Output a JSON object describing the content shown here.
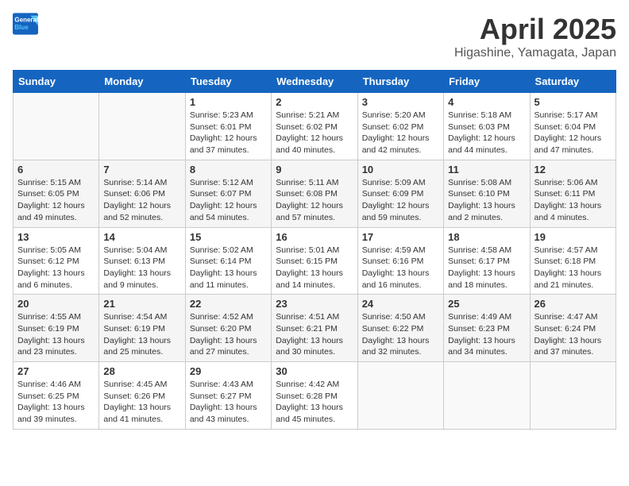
{
  "logo": {
    "line1": "General",
    "line2": "Blue"
  },
  "title": "April 2025",
  "subtitle": "Higashine, Yamagata, Japan",
  "days_of_week": [
    "Sunday",
    "Monday",
    "Tuesday",
    "Wednesday",
    "Thursday",
    "Friday",
    "Saturday"
  ],
  "weeks": [
    [
      {
        "day": "",
        "info": ""
      },
      {
        "day": "",
        "info": ""
      },
      {
        "day": "1",
        "info": "Sunrise: 5:23 AM\nSunset: 6:01 PM\nDaylight: 12 hours and 37 minutes."
      },
      {
        "day": "2",
        "info": "Sunrise: 5:21 AM\nSunset: 6:02 PM\nDaylight: 12 hours and 40 minutes."
      },
      {
        "day": "3",
        "info": "Sunrise: 5:20 AM\nSunset: 6:02 PM\nDaylight: 12 hours and 42 minutes."
      },
      {
        "day": "4",
        "info": "Sunrise: 5:18 AM\nSunset: 6:03 PM\nDaylight: 12 hours and 44 minutes."
      },
      {
        "day": "5",
        "info": "Sunrise: 5:17 AM\nSunset: 6:04 PM\nDaylight: 12 hours and 47 minutes."
      }
    ],
    [
      {
        "day": "6",
        "info": "Sunrise: 5:15 AM\nSunset: 6:05 PM\nDaylight: 12 hours and 49 minutes."
      },
      {
        "day": "7",
        "info": "Sunrise: 5:14 AM\nSunset: 6:06 PM\nDaylight: 12 hours and 52 minutes."
      },
      {
        "day": "8",
        "info": "Sunrise: 5:12 AM\nSunset: 6:07 PM\nDaylight: 12 hours and 54 minutes."
      },
      {
        "day": "9",
        "info": "Sunrise: 5:11 AM\nSunset: 6:08 PM\nDaylight: 12 hours and 57 minutes."
      },
      {
        "day": "10",
        "info": "Sunrise: 5:09 AM\nSunset: 6:09 PM\nDaylight: 12 hours and 59 minutes."
      },
      {
        "day": "11",
        "info": "Sunrise: 5:08 AM\nSunset: 6:10 PM\nDaylight: 13 hours and 2 minutes."
      },
      {
        "day": "12",
        "info": "Sunrise: 5:06 AM\nSunset: 6:11 PM\nDaylight: 13 hours and 4 minutes."
      }
    ],
    [
      {
        "day": "13",
        "info": "Sunrise: 5:05 AM\nSunset: 6:12 PM\nDaylight: 13 hours and 6 minutes."
      },
      {
        "day": "14",
        "info": "Sunrise: 5:04 AM\nSunset: 6:13 PM\nDaylight: 13 hours and 9 minutes."
      },
      {
        "day": "15",
        "info": "Sunrise: 5:02 AM\nSunset: 6:14 PM\nDaylight: 13 hours and 11 minutes."
      },
      {
        "day": "16",
        "info": "Sunrise: 5:01 AM\nSunset: 6:15 PM\nDaylight: 13 hours and 14 minutes."
      },
      {
        "day": "17",
        "info": "Sunrise: 4:59 AM\nSunset: 6:16 PM\nDaylight: 13 hours and 16 minutes."
      },
      {
        "day": "18",
        "info": "Sunrise: 4:58 AM\nSunset: 6:17 PM\nDaylight: 13 hours and 18 minutes."
      },
      {
        "day": "19",
        "info": "Sunrise: 4:57 AM\nSunset: 6:18 PM\nDaylight: 13 hours and 21 minutes."
      }
    ],
    [
      {
        "day": "20",
        "info": "Sunrise: 4:55 AM\nSunset: 6:19 PM\nDaylight: 13 hours and 23 minutes."
      },
      {
        "day": "21",
        "info": "Sunrise: 4:54 AM\nSunset: 6:19 PM\nDaylight: 13 hours and 25 minutes."
      },
      {
        "day": "22",
        "info": "Sunrise: 4:52 AM\nSunset: 6:20 PM\nDaylight: 13 hours and 27 minutes."
      },
      {
        "day": "23",
        "info": "Sunrise: 4:51 AM\nSunset: 6:21 PM\nDaylight: 13 hours and 30 minutes."
      },
      {
        "day": "24",
        "info": "Sunrise: 4:50 AM\nSunset: 6:22 PM\nDaylight: 13 hours and 32 minutes."
      },
      {
        "day": "25",
        "info": "Sunrise: 4:49 AM\nSunset: 6:23 PM\nDaylight: 13 hours and 34 minutes."
      },
      {
        "day": "26",
        "info": "Sunrise: 4:47 AM\nSunset: 6:24 PM\nDaylight: 13 hours and 37 minutes."
      }
    ],
    [
      {
        "day": "27",
        "info": "Sunrise: 4:46 AM\nSunset: 6:25 PM\nDaylight: 13 hours and 39 minutes."
      },
      {
        "day": "28",
        "info": "Sunrise: 4:45 AM\nSunset: 6:26 PM\nDaylight: 13 hours and 41 minutes."
      },
      {
        "day": "29",
        "info": "Sunrise: 4:43 AM\nSunset: 6:27 PM\nDaylight: 13 hours and 43 minutes."
      },
      {
        "day": "30",
        "info": "Sunrise: 4:42 AM\nSunset: 6:28 PM\nDaylight: 13 hours and 45 minutes."
      },
      {
        "day": "",
        "info": ""
      },
      {
        "day": "",
        "info": ""
      },
      {
        "day": "",
        "info": ""
      }
    ]
  ]
}
